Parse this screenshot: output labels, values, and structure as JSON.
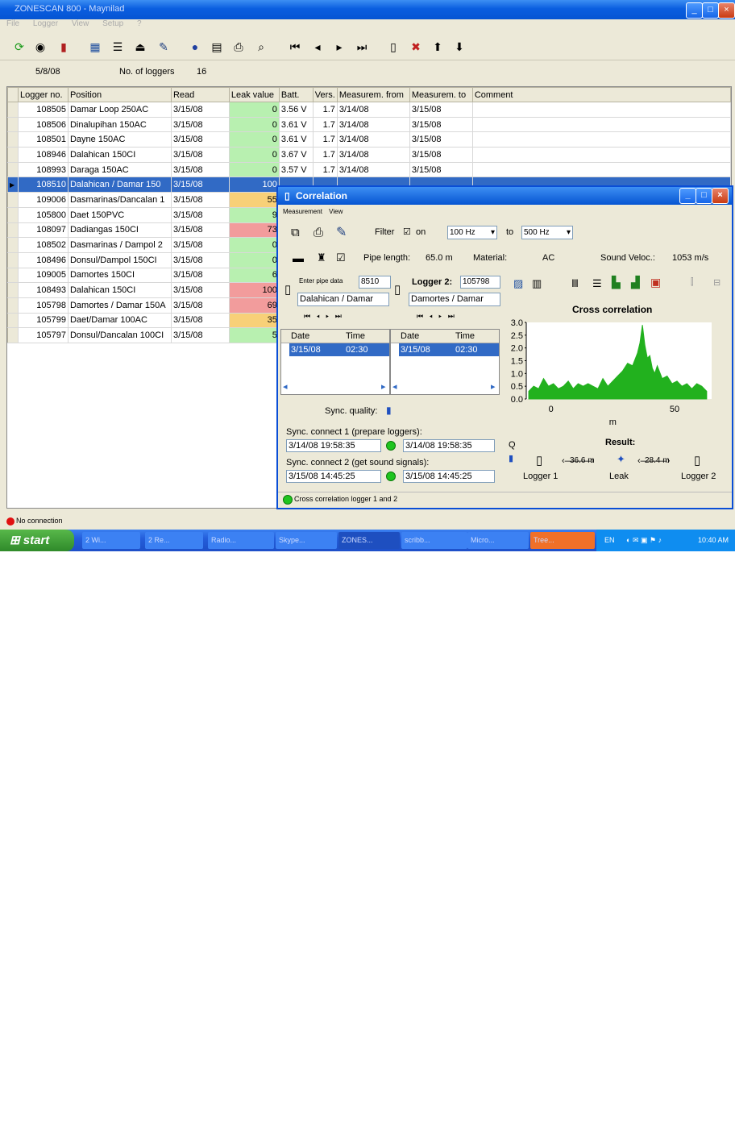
{
  "app": {
    "title": "ZONESCAN 800 - Maynilad",
    "menu": [
      "File",
      "Logger",
      "View",
      "Setup",
      "?"
    ]
  },
  "toolbar_icons": [
    "refresh-icon",
    "eye-icon",
    "logger-read-icon",
    "table-icon",
    "list-icon",
    "device-icon",
    "antenna-icon",
    "help-icon",
    "properties-icon",
    "print-icon",
    "search-icon",
    "first-icon",
    "prev-icon",
    "next-icon",
    "last-icon",
    "bottle-icon",
    "delete-icon",
    "up-icon",
    "down-icon"
  ],
  "info": {
    "date": "5/8/08",
    "loggers_label": "No. of loggers",
    "loggers_count": "16"
  },
  "grid": {
    "columns": [
      "Logger no.",
      "Position",
      "Read",
      "Leak value",
      "Batt.",
      "Vers.",
      "Measurem. from",
      "Measurem. to",
      "Comment"
    ],
    "rows": [
      {
        "no": "108505",
        "pos": "Damar Loop 250AC",
        "read": "3/15/08",
        "leak": "0",
        "batt": "3.56 V",
        "vers": "1.7",
        "from": "3/14/08",
        "to": "3/15/08",
        "level": "green"
      },
      {
        "no": "108506",
        "pos": "Dinalupihan 150AC",
        "read": "3/15/08",
        "leak": "0",
        "batt": "3.61 V",
        "vers": "1.7",
        "from": "3/14/08",
        "to": "3/15/08",
        "level": "green"
      },
      {
        "no": "108501",
        "pos": "Dayne 150AC",
        "read": "3/15/08",
        "leak": "0",
        "batt": "3.61 V",
        "vers": "1.7",
        "from": "3/14/08",
        "to": "3/15/08",
        "level": "green"
      },
      {
        "no": "108946",
        "pos": "Dalahican 150CI",
        "read": "3/15/08",
        "leak": "0",
        "batt": "3.67 V",
        "vers": "1.7",
        "from": "3/14/08",
        "to": "3/15/08",
        "level": "green"
      },
      {
        "no": "108993",
        "pos": "Daraga 150AC",
        "read": "3/15/08",
        "leak": "0",
        "batt": "3.57 V",
        "vers": "1.7",
        "from": "3/14/08",
        "to": "3/15/08",
        "level": "green"
      },
      {
        "no": "108510",
        "pos": "Dalahican / Damar 150",
        "read": "3/15/08",
        "leak": "100",
        "batt": "",
        "vers": "",
        "from": "",
        "to": "",
        "level": "red",
        "selected": true
      },
      {
        "no": "109006",
        "pos": "Dasmarinas/Dancalan 1",
        "read": "3/15/08",
        "leak": "55",
        "batt": "",
        "vers": "",
        "from": "",
        "to": "",
        "level": "yel"
      },
      {
        "no": "105800",
        "pos": "Daet 150PVC",
        "read": "3/15/08",
        "leak": "9",
        "batt": "",
        "vers": "",
        "from": "",
        "to": "",
        "level": "green"
      },
      {
        "no": "108097",
        "pos": "Dadiangas 150CI",
        "read": "3/15/08",
        "leak": "73",
        "batt": "",
        "vers": "",
        "from": "",
        "to": "",
        "level": "red"
      },
      {
        "no": "108502",
        "pos": "Dasmarinas / Dampol 2",
        "read": "3/15/08",
        "leak": "0",
        "batt": "",
        "vers": "",
        "from": "",
        "to": "",
        "level": "green"
      },
      {
        "no": "108496",
        "pos": "Donsul/Dampol 150CI",
        "read": "3/15/08",
        "leak": "0",
        "batt": "",
        "vers": "",
        "from": "",
        "to": "",
        "level": "green"
      },
      {
        "no": "109005",
        "pos": "Damortes 150CI",
        "read": "3/15/08",
        "leak": "6",
        "batt": "",
        "vers": "",
        "from": "",
        "to": "",
        "level": "green"
      },
      {
        "no": "108493",
        "pos": "Dalahican 150CI",
        "read": "3/15/08",
        "leak": "100",
        "batt": "",
        "vers": "",
        "from": "",
        "to": "",
        "level": "red"
      },
      {
        "no": "105798",
        "pos": "Damortes / Damar 150A",
        "read": "3/15/08",
        "leak": "69",
        "batt": "",
        "vers": "",
        "from": "",
        "to": "",
        "level": "red"
      },
      {
        "no": "105799",
        "pos": "Daet/Damar 100AC",
        "read": "3/15/08",
        "leak": "35",
        "batt": "",
        "vers": "",
        "from": "",
        "to": "",
        "level": "yel"
      },
      {
        "no": "105797",
        "pos": "Donsul/Dancalan 100CI",
        "read": "3/15/08",
        "leak": "5",
        "batt": "",
        "vers": "",
        "from": "",
        "to": "",
        "level": "green"
      }
    ]
  },
  "status": {
    "text": "No connection"
  },
  "taskbar": {
    "start": "start",
    "tasks": [
      "2 Wi...",
      "2 Re...",
      "Radio...",
      "Skype...",
      "ZONES...",
      "scribb...",
      "Micro...",
      "Tree..."
    ],
    "lang": "EN",
    "time": "10:40 AM"
  },
  "dialog": {
    "title": "Correlation",
    "menu": [
      "Measurement",
      "View"
    ],
    "filter_label": "Filter",
    "filter_on": "on",
    "freq_from": "100 Hz",
    "to_label": "to",
    "freq_to": "500 Hz",
    "pipe_length_label": "Pipe length:",
    "pipe_length": "65.0 m",
    "material_label": "Material:",
    "material": "AC",
    "sound_label": "Sound Veloc.:",
    "sound_value": "1053 m/s",
    "logger1": {
      "label": "Enter pipe data",
      "no": "8510",
      "pos": "Dalahican / Damar"
    },
    "logger2": {
      "label": "Logger 2:",
      "no": "105798",
      "pos": "Damortes / Damar"
    },
    "table_headers": [
      "Date",
      "Time"
    ],
    "logger1_row": {
      "date": "3/15/08",
      "time": "02:30"
    },
    "logger2_row": {
      "date": "3/15/08",
      "time": "02:30"
    },
    "sync_quality_label": "Sync. quality:",
    "sync1_label": "Sync. connect 1 (prepare loggers):",
    "sync1_a": "3/14/08 19:58:35",
    "sync1_b": "3/14/08 19:58:35",
    "sync2_label": "Sync. connect 2 (get sound signals):",
    "sync2_a": "3/15/08 14:45:25",
    "sync2_b": "3/15/08 14:45:25",
    "bottom": "Cross correlation logger 1 and 2",
    "result": {
      "title": "Result:",
      "q_label": "Q",
      "dist1": "36.6 m",
      "dist2": "28.4 m",
      "logger1": "Logger 1",
      "leak": "Leak",
      "logger2": "Logger 2"
    }
  },
  "chart_data": {
    "type": "area",
    "title": "Cross correlation",
    "xlabel": "m",
    "ylabel": "",
    "xlim": [
      -10,
      65
    ],
    "ylim": [
      0,
      3.0
    ],
    "yticks": [
      "0.0",
      "0.5",
      "1.0",
      "1.5",
      "2.0",
      "2.5",
      "3.0"
    ],
    "xticks": [
      "0",
      "50"
    ],
    "color": "#22b11e",
    "x": [
      -9,
      -7,
      -5,
      -3,
      -1,
      1,
      3,
      5,
      7,
      9,
      11,
      13,
      15,
      17,
      19,
      21,
      23,
      25,
      27,
      29,
      31,
      33,
      35,
      36,
      37,
      38,
      39,
      40,
      41,
      42,
      43,
      45,
      47,
      49,
      51,
      53,
      55,
      57,
      59,
      61,
      63
    ],
    "values": [
      0.3,
      0.5,
      0.4,
      0.8,
      0.5,
      0.6,
      0.4,
      0.5,
      0.7,
      0.4,
      0.6,
      0.5,
      0.6,
      0.5,
      0.4,
      0.8,
      0.5,
      0.7,
      0.9,
      1.1,
      1.4,
      1.3,
      1.8,
      2.2,
      2.9,
      2.1,
      1.6,
      1.7,
      1.2,
      1.0,
      1.3,
      0.8,
      0.9,
      0.6,
      0.7,
      0.5,
      0.6,
      0.4,
      0.6,
      0.5,
      0.3
    ]
  },
  "colors": {
    "accent": "#0a4ed6",
    "selected": "#316ac5",
    "leak_green": "#b8f0b0",
    "leak_red": "#f29c9c",
    "leak_yellow": "#f8d078",
    "chart": "#22b11e"
  }
}
